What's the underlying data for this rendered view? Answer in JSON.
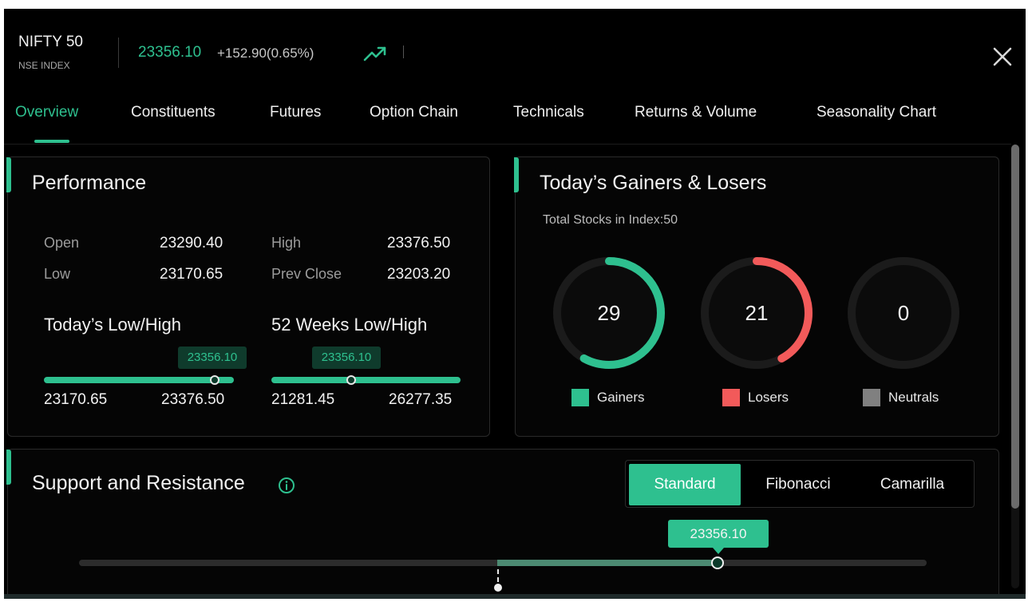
{
  "header": {
    "index_name": "NIFTY 50",
    "exchange": "NSE INDEX",
    "price": "23356.10",
    "change": "+152.90(0.65%)",
    "trend_icon": "trending-up-icon",
    "close_icon": "close-icon"
  },
  "tabs": [
    {
      "label": "Overview",
      "active": true
    },
    {
      "label": "Constituents",
      "active": false
    },
    {
      "label": "Futures",
      "active": false
    },
    {
      "label": "Option Chain",
      "active": false
    },
    {
      "label": "Technicals",
      "active": false
    },
    {
      "label": "Returns & Volume",
      "active": false
    },
    {
      "label": "Seasonality Chart",
      "active": false
    }
  ],
  "performance": {
    "title": "Performance",
    "open_label": "Open",
    "open_value": "23290.40",
    "high_label": "High",
    "high_value": "23376.50",
    "low_label": "Low",
    "low_value": "23170.65",
    "prev_close_label": "Prev Close",
    "prev_close_value": "23203.20",
    "today": {
      "title": "Today’s Low/High",
      "current": "23356.10",
      "low": "23170.65",
      "high": "23376.50",
      "position_fraction": 0.9
    },
    "week52": {
      "title": "52 Weeks Low/High",
      "current": "23356.10",
      "low": "21281.45",
      "high": "26277.35",
      "position_fraction": 0.42
    }
  },
  "gainers_losers": {
    "title": "Today’s Gainers & Losers",
    "total_label": "Total Stocks in Index:50",
    "total": 50,
    "gainers": {
      "count": "29",
      "label": "Gainers",
      "color": "#2ec08f",
      "value": 29
    },
    "losers": {
      "count": "21",
      "label": "Losers",
      "color": "#f25a5a",
      "value": 21
    },
    "neutrals": {
      "count": "0",
      "label": "Neutrals",
      "color": "#808080",
      "value": 0
    }
  },
  "support_resistance": {
    "title": "Support and Resistance",
    "info_icon": "info-icon",
    "modes": [
      {
        "label": "Standard",
        "active": true
      },
      {
        "label": "Fibonacci",
        "active": false
      },
      {
        "label": "Camarilla",
        "active": false
      }
    ],
    "current": "23356.10"
  }
}
